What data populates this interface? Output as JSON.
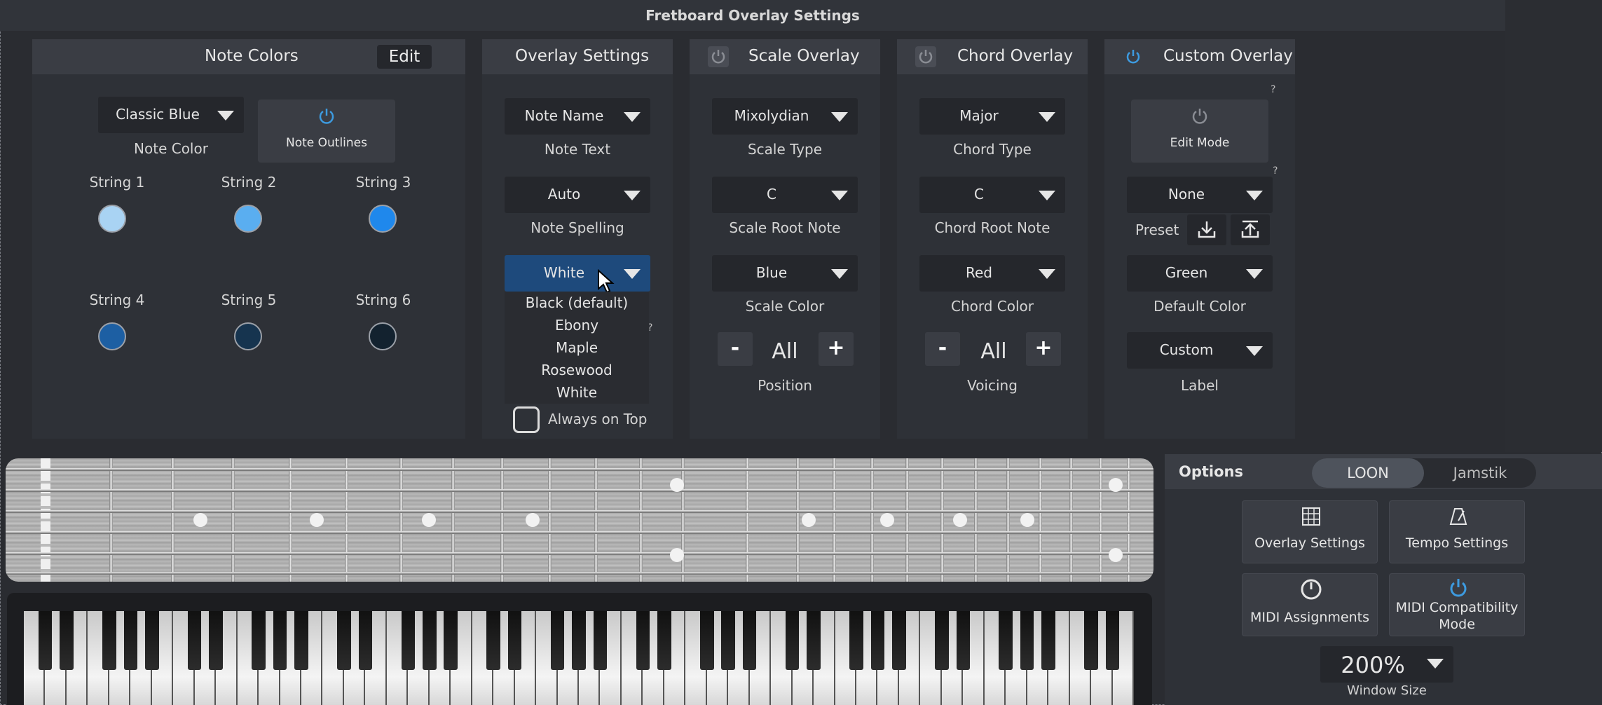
{
  "window": {
    "title": "Fretboard Overlay Settings"
  },
  "note_colors": {
    "title": "Note Colors",
    "edit_label": "Edit",
    "note_color_value": "Classic Blue",
    "note_color_label": "Note Color",
    "note_outlines_label": "Note Outlines",
    "strings": [
      {
        "label": "String 1",
        "color": "#a9d3f3"
      },
      {
        "label": "String 2",
        "color": "#5aaef0"
      },
      {
        "label": "String 3",
        "color": "#1f88ec"
      },
      {
        "label": "String 4",
        "color": "#1d5fa3"
      },
      {
        "label": "String 5",
        "color": "#16344f"
      },
      {
        "label": "String 6",
        "color": "#13222f"
      }
    ]
  },
  "overlay_settings": {
    "title": "Overlay Settings",
    "note_text_value": "Note Name",
    "note_text_label": "Note Text",
    "note_spelling_value": "Auto",
    "note_spelling_label": "Note Spelling",
    "fretboard_value": "White",
    "fretboard_options": [
      "Black (default)",
      "Ebony",
      "Maple",
      "Rosewood",
      "White"
    ],
    "question": "?",
    "always_on_top_label": "Always on Top"
  },
  "scale_overlay": {
    "title": "Scale Overlay",
    "scale_type_value": "Mixolydian",
    "scale_type_label": "Scale Type",
    "root_value": "C",
    "root_label": "Scale Root Note",
    "color_value": "Blue",
    "color_label": "Scale Color",
    "minus": "-",
    "plus": "+",
    "position_value": "All",
    "position_label": "Position"
  },
  "chord_overlay": {
    "title": "Chord Overlay",
    "chord_type_value": "Major",
    "chord_type_label": "Chord Type",
    "root_value": "C",
    "root_label": "Chord Root Note",
    "color_value": "Red",
    "color_label": "Chord Color",
    "minus": "-",
    "plus": "+",
    "voicing_value": "All",
    "voicing_label": "Voicing"
  },
  "custom_overlay": {
    "title": "Custom Overlay",
    "edit_mode_label": "Edit Mode",
    "question": "?",
    "preset_value": "None",
    "preset_label": "Preset",
    "default_color_value": "Green",
    "default_color_label": "Default Color",
    "label_value": "Custom",
    "label_label": "Label"
  },
  "options": {
    "title": "Options",
    "segments": [
      "LOON",
      "Jamstik"
    ],
    "overlay_settings_label": "Overlay Settings",
    "tempo_settings_label": "Tempo Settings",
    "midi_assignments_label": "MIDI Assignments",
    "midi_compat_line1": "MIDI Compatibility",
    "midi_compat_line2": "Mode",
    "window_size_value": "200%",
    "window_size_label": "Window Size"
  },
  "colors": {
    "accent": "#3d9be0",
    "selected": "#1e4a7c",
    "panel": "#2e3137"
  }
}
